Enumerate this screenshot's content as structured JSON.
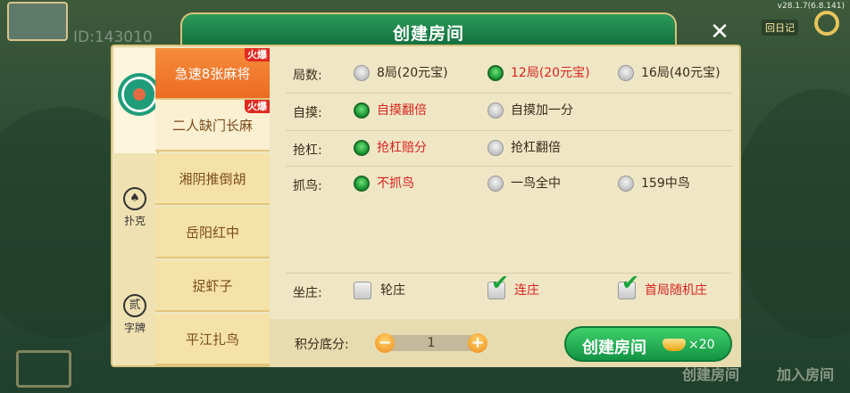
{
  "background": {
    "version": "v28.1.7(6.8.141)",
    "id_text": "ID:143010",
    "top_right_label": "回日记",
    "bottom_create": "创建房间",
    "bottom_join": "加入房间"
  },
  "dialog": {
    "title": "创建房间",
    "close_glyph": "✕"
  },
  "categories": [
    {
      "label": "扑克",
      "icon": "spade-icon",
      "glyph": "♠"
    },
    {
      "label": "字牌",
      "icon": "zipai-icon",
      "glyph": "贰"
    }
  ],
  "games": [
    {
      "label": "急速8张麻将",
      "hot": "火爆",
      "selected": true
    },
    {
      "label": "二人缺门长麻",
      "hot": "火爆",
      "selected": false
    },
    {
      "label": "湘阴推倒胡",
      "hot": "",
      "selected": false
    },
    {
      "label": "岳阳红中",
      "hot": "",
      "selected": false
    },
    {
      "label": "捉虾子",
      "hot": "",
      "selected": false
    },
    {
      "label": "平江扎鸟",
      "hot": "",
      "selected": false
    }
  ],
  "options": {
    "rounds": {
      "label": "局数:",
      "choices": [
        "8局(20元宝)",
        "12局(20元宝)",
        "16局(40元宝)"
      ],
      "selected": 1
    },
    "zimo": {
      "label": "自摸:",
      "choices": [
        "自摸翻倍",
        "自摸加一分"
      ],
      "selected": 0
    },
    "qianggang": {
      "label": "抢杠:",
      "choices": [
        "抢杠赔分",
        "抢杠翻倍"
      ],
      "selected": 0
    },
    "zhuaniao": {
      "label": "抓鸟:",
      "choices": [
        "不抓鸟",
        "一鸟全中",
        "159中鸟"
      ],
      "selected": 0
    },
    "zuozhuang": {
      "label": "坐庄:",
      "choices": [
        "轮庄",
        "连庄",
        "首局随机庄"
      ],
      "checked": [
        false,
        true,
        true
      ]
    }
  },
  "footer": {
    "score_label": "积分底分:",
    "score_value": "1",
    "minus": "−",
    "plus": "+",
    "create_label": "创建房间",
    "cost": "×20"
  },
  "colors": {
    "accent_green": "#15952e",
    "selected_tab": "#ec6b24",
    "selected_text": "#d9241e"
  }
}
